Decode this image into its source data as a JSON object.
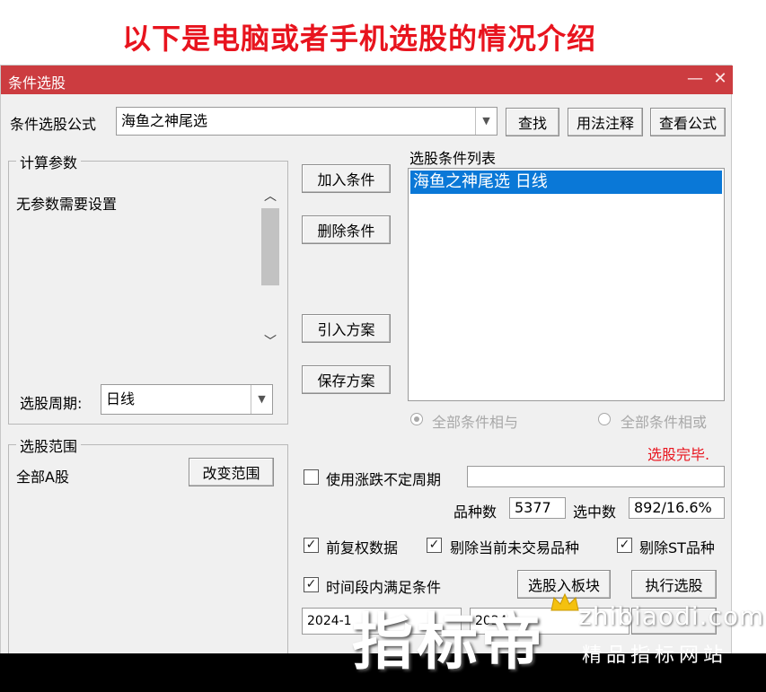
{
  "headline": "以下是电脑或者手机选股的情况介绍",
  "window": {
    "title": "条件选股",
    "minimize_glyph": "—",
    "close_glyph": "✕"
  },
  "formula": {
    "label": "条件选股公式",
    "value": "海鱼之神尾选",
    "find_button": "查找",
    "usage_button": "用法注释",
    "view_button": "查看公式"
  },
  "params": {
    "legend": "计算参数",
    "text": "无参数需要设置",
    "period_label": "选股周期:",
    "period_value": "日线"
  },
  "middle_buttons": {
    "add": "加入条件",
    "delete": "删除条件",
    "import": "引入方案",
    "save": "保存方案"
  },
  "conditions": {
    "label": "选股条件列表",
    "items": [
      "海鱼之神尾选  日线"
    ],
    "radio_and": "全部条件相与",
    "radio_or": "全部条件相或",
    "status": "选股完毕."
  },
  "scope": {
    "legend": "选股范围",
    "value": "全部A股",
    "change_button": "改变范围"
  },
  "options": {
    "use_variable_period": "使用涨跌不定周期",
    "count_label": "品种数",
    "count_value": "5377",
    "selected_label": "选中数",
    "selected_value": "892/16.6%",
    "adjusted_data": "前复权数据",
    "exclude_untraded": "剔除当前未交易品种",
    "exclude_st": "剔除ST品种",
    "time_range": "时间段内满足条件",
    "to_block_button": "选股入板块",
    "execute_button": "执行选股",
    "date_start": "2024-1",
    "date_end": "2024-"
  },
  "watermark": {
    "brand": "指标帝",
    "url": "zhibiaodi.com",
    "tagline": "精品指标网站"
  },
  "colors": {
    "titlebar": "#cc3c40",
    "headline": "#e8141e",
    "selection": "#0a78d7",
    "status": "#e8141e"
  }
}
